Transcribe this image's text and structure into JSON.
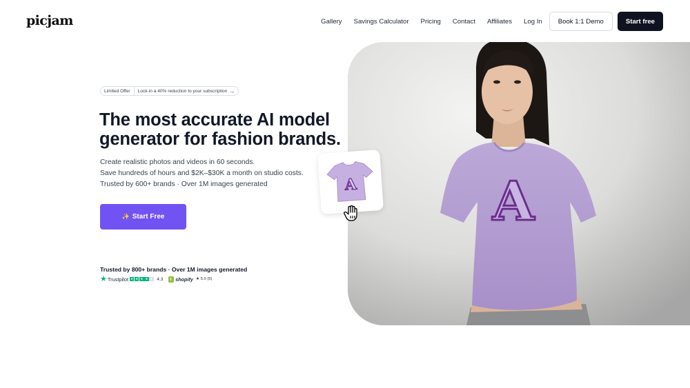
{
  "brand": {
    "logo": "picjam"
  },
  "nav": {
    "links": [
      "Gallery",
      "Savings Calculator",
      "Pricing",
      "Contact",
      "Affiliates",
      "Log In"
    ],
    "demo_button": "Book 1:1 Demo",
    "start_button": "Start free"
  },
  "hero": {
    "offer_tag": "Limited Offer",
    "offer_text": "Lock-in a 40% reduction to your subscription",
    "offer_arrow": "→",
    "headline_line1": "The most accurate AI model",
    "headline_line2": "generator for fashion brands.",
    "sub_line1": "Create realistic photos and videos in 60 seconds.",
    "sub_line2": "Save hundreds of hours and $2K–$30K a month on studio costs.",
    "sub_line3": "Trusted by 600+ brands  · Over 1M images generated",
    "cta_icon": "sparkle-icon",
    "cta_label": "Start Free",
    "trusted_text": "Trusted by 800+ brands  · Over 1M images generated"
  },
  "ratings": {
    "trustpilot_name": "Trustpilot",
    "trustpilot_score": "4.3",
    "trustpilot_stars": 4,
    "shopify_name": "shopify",
    "shopify_score": "★ 5.0 (5)"
  },
  "image": {
    "shirt_letter": "A",
    "colors": {
      "shirt": "#b6a1d2",
      "letter": "#6a2e8c",
      "accent": "#7152f3",
      "trustpilot": "#00b67a",
      "shopify": "#95bf47"
    }
  }
}
